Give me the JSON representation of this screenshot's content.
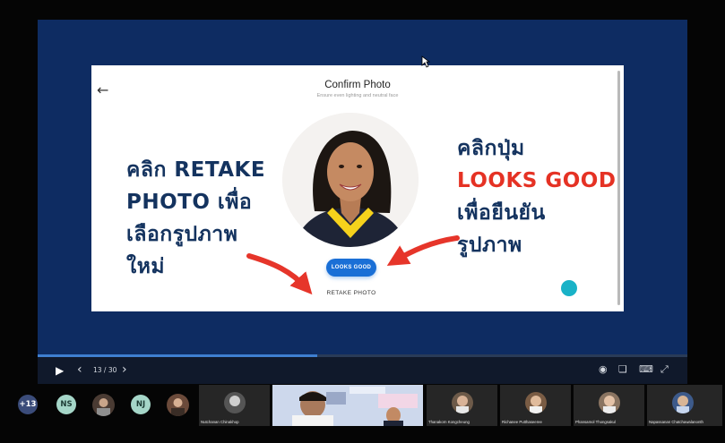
{
  "slide": {
    "back_icon": "back-arrow-icon",
    "title": "Confirm Photo",
    "subtitle": "Ensure even lighting and neutral face",
    "looks_good_label": "LOOKS GOOD",
    "retake_label": "RETAKE PHOTO"
  },
  "annotation_left": {
    "line1": "คลิก RETAKE",
    "line2": "PHOTO เพื่อ",
    "line3": "เลือกรูปภาพ",
    "line4": "ใหม่"
  },
  "annotation_right": {
    "line1": "คลิกปุ่ม",
    "line2": "LOOKS GOOD",
    "line3": "เพื่อยืนยัน",
    "line4": "รูปภาพ"
  },
  "colors": {
    "stage_bg": "#0e2c62",
    "annotation_text": "#14335f",
    "annotation_accent": "#e53224",
    "button_blue": "#1a6fd6",
    "arrow_red": "#e6352a"
  },
  "player": {
    "page_counter": "13 / 30",
    "progress": 0.43,
    "play_icon": "play-icon",
    "prev_icon": "chevron-left-icon",
    "next_icon": "chevron-right-icon",
    "right_icons": [
      "broadcast-icon",
      "copy-icon",
      "keyboard-icon",
      "collapse-icon"
    ]
  },
  "participants": {
    "overflow_count": "+13",
    "badges": [
      {
        "initials": "NS",
        "color": "#a5d6c8"
      },
      {
        "initials": "NJ",
        "color": "#a5d6c8"
      }
    ],
    "tiles": [
      {
        "name": "Nutchanan Chinakhop"
      },
      {
        "name": "Thanakorn Kongcheung"
      },
      {
        "name": "Richanee Putthaseeree"
      },
      {
        "name": "Phansamol Thongsakul"
      },
      {
        "name": "Napassanan Chatchawalanonth"
      }
    ]
  }
}
